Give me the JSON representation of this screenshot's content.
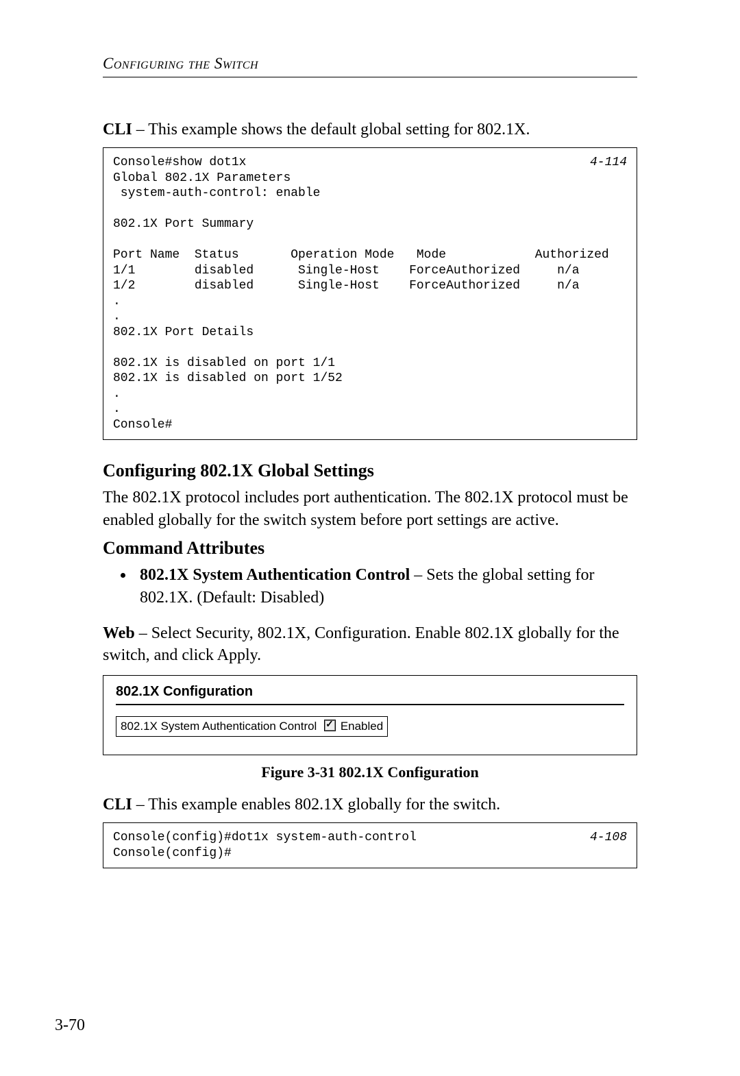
{
  "header": {
    "running": "Configuring the Switch"
  },
  "p1": {
    "lead": "CLI",
    "rest": " – This example shows the default global setting for 802.1X."
  },
  "cli1": {
    "ref": "4-114",
    "text": "Console#show dot1x\nGlobal 802.1X Parameters\n system-auth-control: enable\n\n802.1X Port Summary\n\nPort Name  Status       Operation Mode   Mode            Authorized\n1/1        disabled      Single-Host    ForceAuthorized     n/a\n1/2        disabled      Single-Host    ForceAuthorized     n/a\n.\n.\n802.1X Port Details\n\n802.1X is disabled on port 1/1\n802.1X is disabled on port 1/52\n.\n.\nConsole#"
  },
  "h2a": "Configuring 802.1X Global Settings",
  "p2": "The 802.1X protocol includes port authentication. The 802.1X protocol must be enabled globally for the switch system before port settings are active.",
  "h2b": "Command Attributes",
  "bullet1": {
    "lead": "802.1X System Authentication Control",
    "rest": " – Sets the global setting for 802.1X. (Default: Disabled)"
  },
  "p3": {
    "lead": "Web",
    "rest": " – Select Security, 802.1X, Configuration. Enable 802.1X globally for the switch, and click Apply."
  },
  "figure": {
    "panel_title": "802.1X Configuration",
    "control_label": "802.1X System Authentication Control",
    "checkbox_label": "Enabled",
    "caption": "Figure 3-31  802.1X Configuration"
  },
  "p4": {
    "lead": "CLI",
    "rest": " – This example enables 802.1X globally for the switch."
  },
  "cli2": {
    "ref": "4-108",
    "text": "Console(config)#dot1x system-auth-control\nConsole(config)#"
  },
  "page_number": "3-70"
}
